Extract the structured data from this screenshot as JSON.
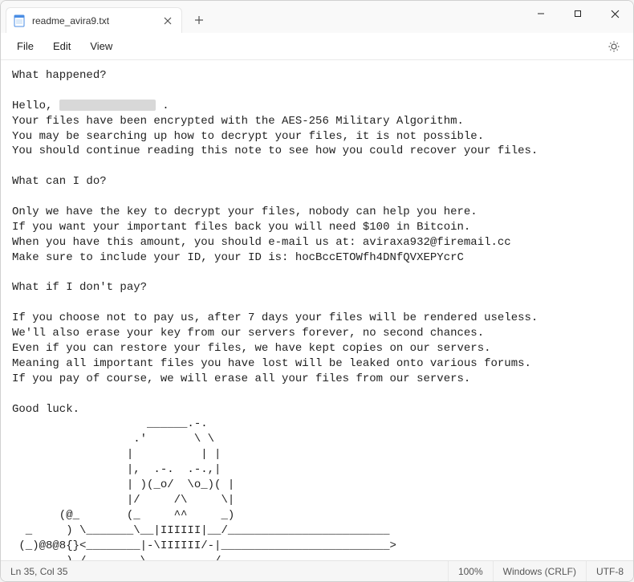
{
  "window": {
    "tab_title": "readme_avira9.txt"
  },
  "menubar": {
    "file": "File",
    "edit": "Edit",
    "view": "View"
  },
  "content": {
    "line1": "What happened?",
    "line2": "",
    "line3a": "Hello, ",
    "line3b": " .",
    "line4": "Your files have been encrypted with the AES-256 Military Algorithm.",
    "line5": "You may be searching up how to decrypt your files, it is not possible.",
    "line6": "You should continue reading this note to see how you could recover your files.",
    "line7": "",
    "line8": "What can I do?",
    "line9": "",
    "line10": "Only we have the key to decrypt your files, nobody can help you here.",
    "line11": "If you want your important files back you will need $100 in Bitcoin.",
    "line12": "When you have this amount, you should e-mail us at: aviraxa932@firemail.cc",
    "line13": "Make sure to include your ID, your ID is: hocBccETOWfh4DNfQVXEPYcrC",
    "line14": "",
    "line15": "What if I don't pay?",
    "line16": "",
    "line17": "If you choose not to pay us, after 7 days your files will be rendered useless.",
    "line18": "We'll also erase your key from our servers forever, no second chances.",
    "line19": "Even if you can restore your files, we have kept copies on our servers.",
    "line20": "Meaning all important files you have lost will be leaked onto various forums.",
    "line21": "If you pay of course, we will erase all your files from our servers.",
    "line22": "",
    "line23": "Good luck.",
    "ascii": "                    ______.-.\n                  .'       \\ \\\n                 |          | |\n                 |,  .-.  .-.,|\n                 | )(_o/  \\o_)( |\n                 |/     /\\     \\|\n       (@_       (_     ^^     _)\n  _     ) \\_______\\__|IIIIII|__/________________________\n (_)@8@8{}<________|-\\IIIIII/-|_________________________>\n        )_/        \\          /\n       (@           `--------`"
  },
  "statusbar": {
    "position": "Ln 35, Col 35",
    "zoom": "100%",
    "line_ending": "Windows (CRLF)",
    "encoding": "UTF-8"
  }
}
